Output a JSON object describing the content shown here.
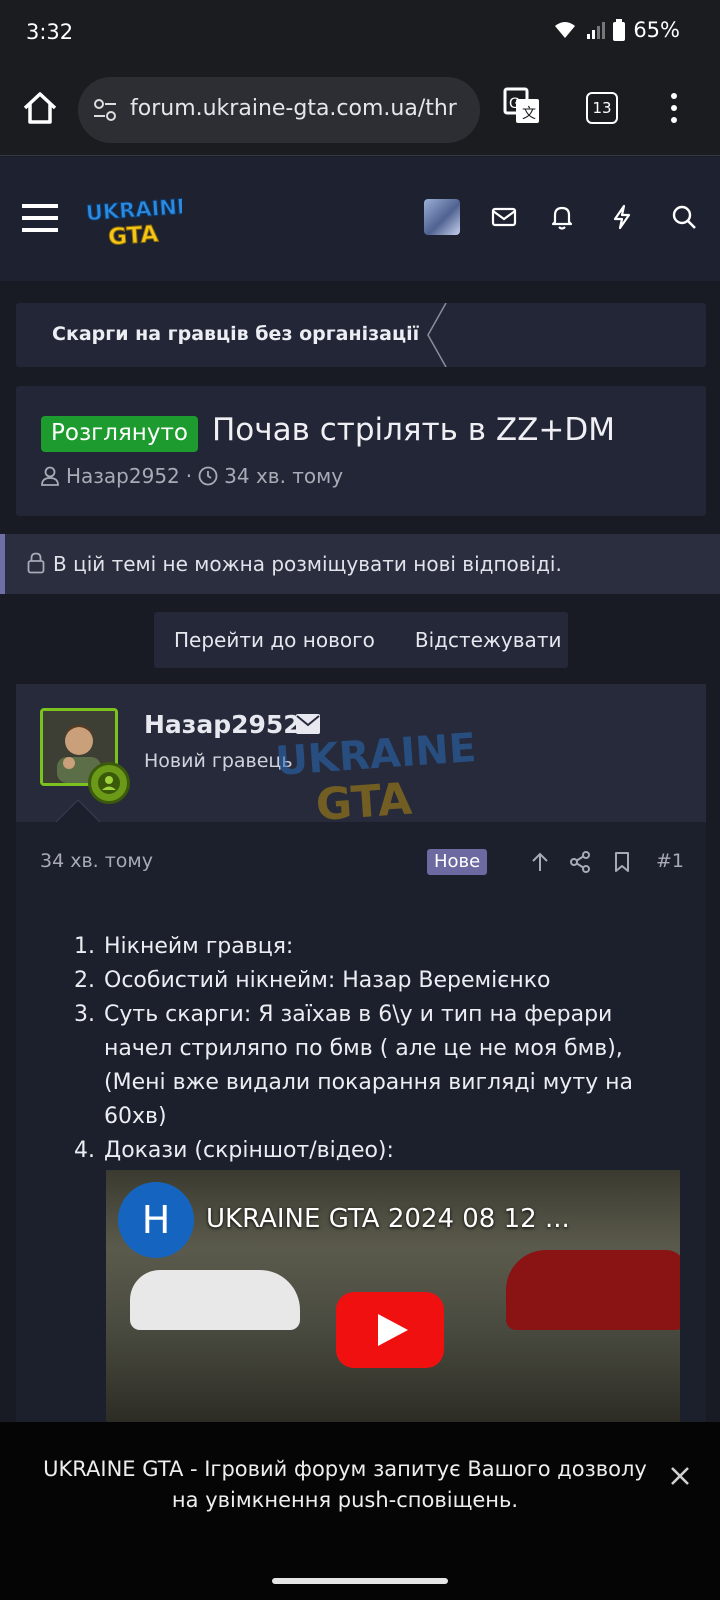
{
  "status_bar": {
    "time": "3:32",
    "battery": "65%"
  },
  "browser": {
    "url": "forum.ukraine-gta.com.ua/thr",
    "tab_count": "13"
  },
  "site": {
    "logo_text": "UKRAINE GTA"
  },
  "breadcrumb": {
    "label": "Скарги на гравців без організації"
  },
  "thread": {
    "prefix": "Розглянуто",
    "title": "Почав стрілять в ZZ+DM",
    "author": "Назар2952",
    "time": "34 хв. тому"
  },
  "notice": {
    "locked_text": "В цій темі не можна розміщувати нові відповіді."
  },
  "actions": {
    "go_to_new": "Перейти до нового",
    "watch": "Відстежувати"
  },
  "post": {
    "username": "Назар2952",
    "user_title": "Новий гравець",
    "time": "34 хв. тому",
    "new_badge": "Нове",
    "number": "#1",
    "items": [
      {
        "num": "1.",
        "text": "Нікнейм гравця:"
      },
      {
        "num": "2.",
        "text": "Особистий нікнейм: Назар Веремієнко"
      },
      {
        "num": "3.",
        "text": "Суть скарги: Я заїхав в 6\\у и тип на ферари начел стриляпо по бмв ( але це не моя бмв), (Мені вже видали покарання вигляді муту на 60хв)"
      },
      {
        "num": "4.",
        "text": "Докази (скріншот/відео):"
      }
    ],
    "video": {
      "channel_letter": "Н",
      "title": "UKRAINE GTA 2024 08 12 ..."
    }
  },
  "push_prompt": {
    "text": "UKRAINE GTA - Ігровий форум запитує Вашого дозволу на увімкнення push-сповіщень."
  },
  "colors": {
    "accent_green": "#1e9b2e",
    "header_bg": "#1d2130",
    "new_badge": "#6c6aa0"
  }
}
